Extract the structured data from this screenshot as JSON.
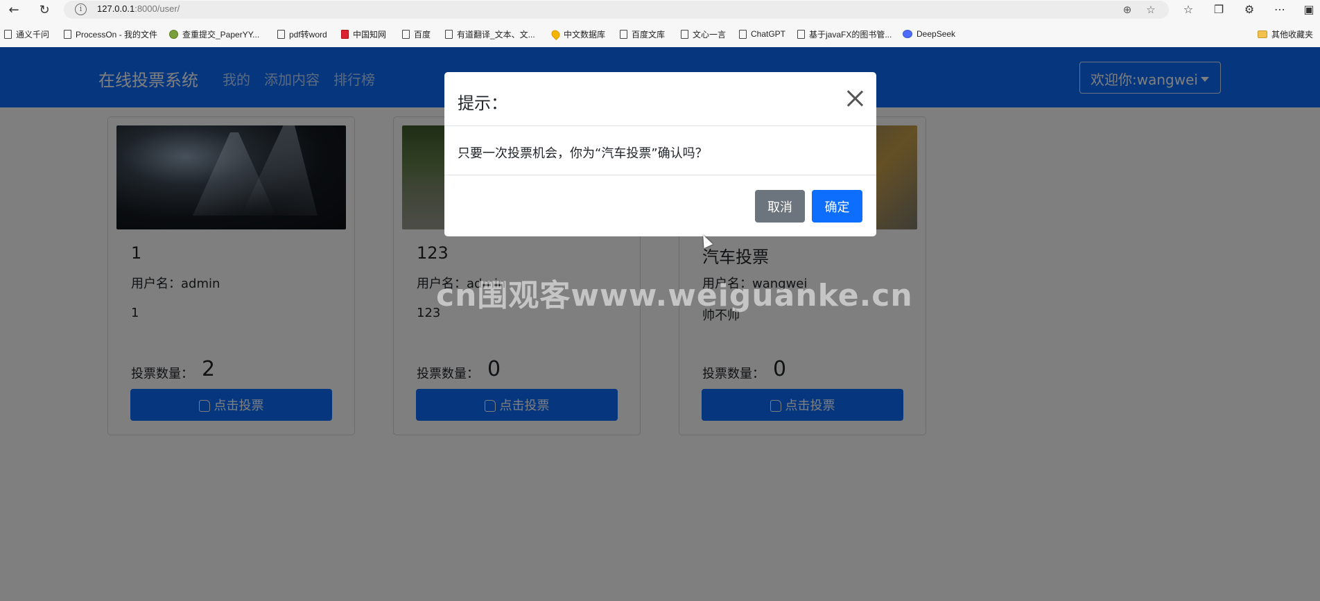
{
  "browser": {
    "url_host": "127.0.0.1",
    "url_rest": ":8000/user/",
    "bookmarks": [
      "通义千问",
      "ProcessOn - 我的文件",
      "查重提交_PaperYY...",
      "pdf转word",
      "中国知网",
      "百度",
      "有道翻译_文本、文...",
      "中文数据库",
      "百度文库",
      "文心一言",
      "ChatGPT",
      "基于javaFX的图书管...",
      "DeepSeek",
      "其他收藏夹"
    ]
  },
  "navbar": {
    "brand": "在线投票系统",
    "links": [
      "我的",
      "添加内容",
      "排行榜"
    ],
    "user_menu": "欢迎你:wangwei"
  },
  "cards": [
    {
      "title": "1",
      "user": "用户名：admin",
      "desc": "1",
      "vote_label": "投票数量：",
      "votes": "2",
      "button": "点击投票"
    },
    {
      "title": "123",
      "user": "用户名：admin",
      "desc": "123",
      "vote_label": "投票数量：",
      "votes": "0",
      "button": "点击投票"
    },
    {
      "title": "汽车投票",
      "user": "用户名：wangwei",
      "desc": "帅不帅",
      "vote_label": "投票数量：",
      "votes": "0",
      "button": "点击投票"
    }
  ],
  "modal": {
    "title": "提示：",
    "message": "只要一次投票机会，你为“汽车投票”确认吗？",
    "cancel": "取消",
    "ok": "确定"
  },
  "watermark": "cn围观客www.weiguanke.cn",
  "colors": {
    "primary": "#0d6efd",
    "secondary": "#6c757d"
  }
}
